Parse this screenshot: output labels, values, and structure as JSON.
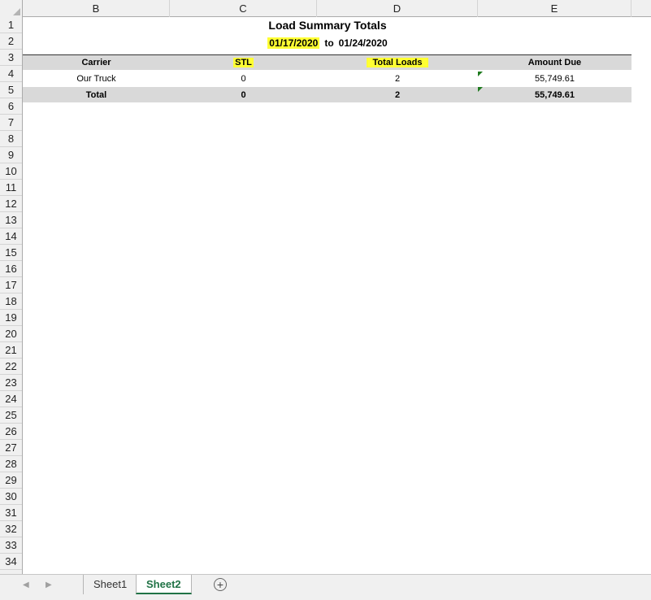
{
  "columns": [
    "B",
    "C",
    "D",
    "E"
  ],
  "rows": [
    "1",
    "2",
    "3",
    "4",
    "5",
    "6",
    "7",
    "8",
    "9",
    "10",
    "11",
    "12",
    "13",
    "14",
    "15",
    "16",
    "17",
    "18",
    "19",
    "20",
    "21",
    "22",
    "23",
    "24",
    "25",
    "26",
    "27",
    "28",
    "29",
    "30",
    "31",
    "32",
    "33",
    "34"
  ],
  "report": {
    "title": "Load Summary Totals",
    "date_from": "01/17/2020",
    "date_sep": "to",
    "date_to": "01/24/2020"
  },
  "table": {
    "headers": [
      "Carrier",
      "STL",
      "Total Loads",
      "Amount Due"
    ],
    "rows": [
      [
        "Our Truck",
        "0",
        "2",
        "55,749.61"
      ]
    ],
    "total": [
      "Total",
      "0",
      "2",
      "55,749.61"
    ]
  },
  "sheets": {
    "tabs": [
      "Sheet1",
      "Sheet2"
    ],
    "active": "Sheet2",
    "add_label": "+"
  },
  "colors": {
    "highlight": "#ffff33",
    "band": "#d9d9d9",
    "active_tab": "#217346"
  }
}
